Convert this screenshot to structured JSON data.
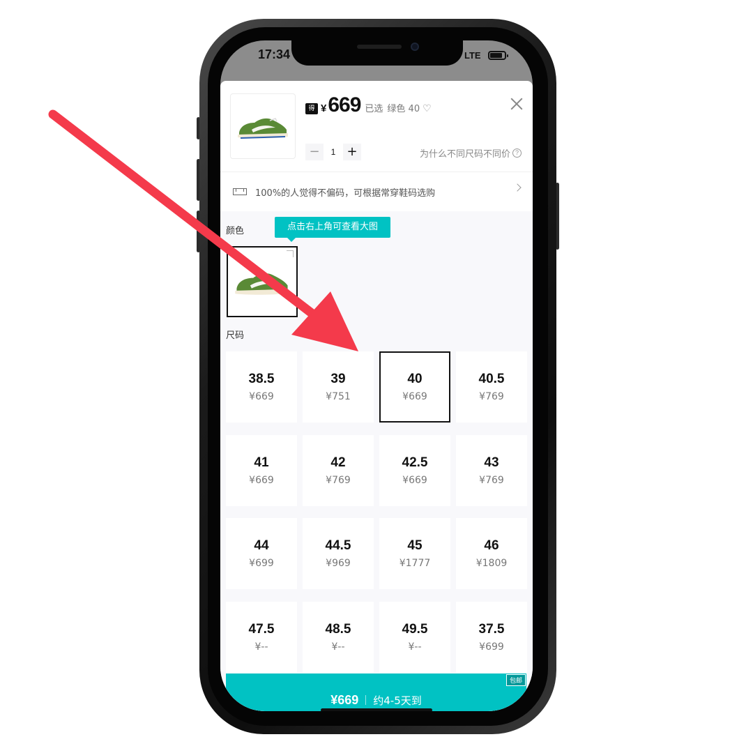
{
  "status_bar": {
    "time": "17:34",
    "network": "LTE"
  },
  "product": {
    "currency_symbol": "¥",
    "price": "669",
    "selected_label": "已选",
    "selected_value": "绿色 40",
    "quantity": "1",
    "size_price_help": "为什么不同尺码不同价",
    "fit_hint": "100%的人觉得不偏码，可根据常穿鞋码选购"
  },
  "color_section": {
    "label": "颜色",
    "tooltip": "点击右上角可查看大图"
  },
  "size_section": {
    "label": "尺码",
    "sizes": [
      {
        "size": "38.5",
        "price": "¥669"
      },
      {
        "size": "39",
        "price": "¥751"
      },
      {
        "size": "40",
        "price": "¥669",
        "selected": true
      },
      {
        "size": "40.5",
        "price": "¥769"
      },
      {
        "size": "41",
        "price": "¥669"
      },
      {
        "size": "42",
        "price": "¥769"
      },
      {
        "size": "42.5",
        "price": "¥669"
      },
      {
        "size": "43",
        "price": "¥769"
      },
      {
        "size": "44",
        "price": "¥699"
      },
      {
        "size": "44.5",
        "price": "¥969"
      },
      {
        "size": "45",
        "price": "¥1777"
      },
      {
        "size": "46",
        "price": "¥1809"
      },
      {
        "size": "47.5",
        "price": "¥--"
      },
      {
        "size": "48.5",
        "price": "¥--"
      },
      {
        "size": "49.5",
        "price": "¥--"
      },
      {
        "size": "37.5",
        "price": "¥699"
      }
    ]
  },
  "buy_button": {
    "price": "¥669",
    "eta": "约4-5天到",
    "badge": "包邮"
  },
  "colors": {
    "accent": "#01c2c3",
    "arrow": "#f43a4b",
    "shoe_green": "#5a8a36"
  }
}
